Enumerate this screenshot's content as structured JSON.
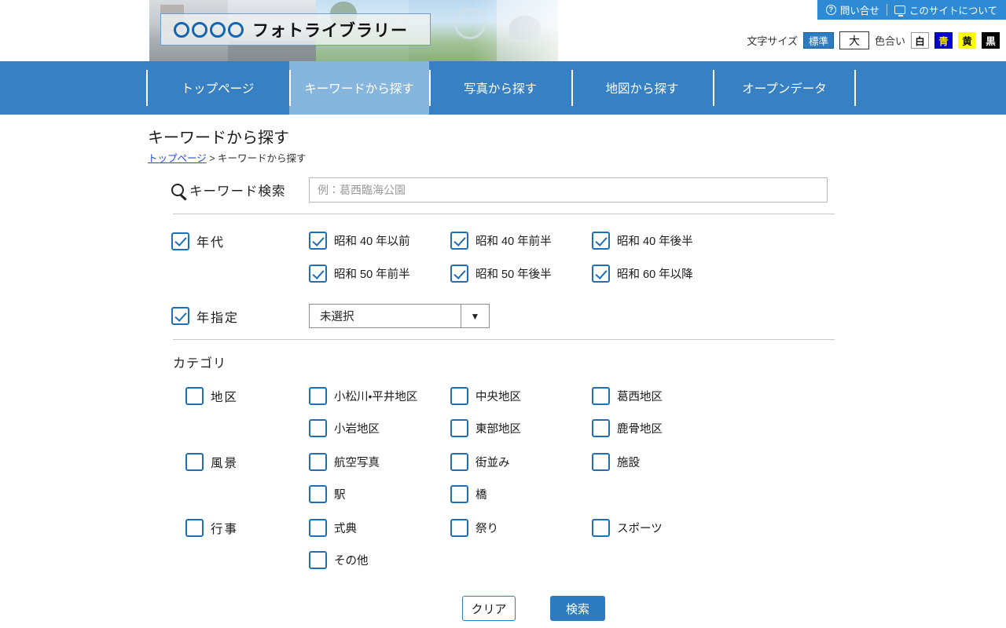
{
  "header": {
    "logo_circles": 4,
    "logo_text": "フォトライブラリー",
    "utility": {
      "contact": "問い合せ",
      "about": "このサイトについて",
      "contact_icon": "question-circle-icon",
      "about_icon": "monitor-icon"
    },
    "preferences": {
      "text_size_label": "文字サイズ",
      "size_standard": "標準",
      "size_large": "大",
      "color_label": "色合い",
      "color_white": "白",
      "color_blue": "青",
      "color_yellow": "黄",
      "color_black": "黒"
    }
  },
  "nav": {
    "items": [
      {
        "label": "トップページ",
        "active": false
      },
      {
        "label": "キーワードから探す",
        "active": true
      },
      {
        "label": "写真から探す",
        "active": false
      },
      {
        "label": "地図から探す",
        "active": false
      },
      {
        "label": "オープンデータ",
        "active": false
      }
    ]
  },
  "page": {
    "title": "キーワードから探す",
    "breadcrumb_home": "トップページ",
    "breadcrumb_sep": ">",
    "breadcrumb_current": "キーワードから探す"
  },
  "search": {
    "label": "キーワード検索",
    "icon": "search-icon",
    "value": "",
    "placeholder": "例：葛西臨海公園"
  },
  "era": {
    "group_label": "年代",
    "group_checked": true,
    "options": [
      {
        "label": "昭和 40 年以前",
        "checked": true
      },
      {
        "label": "昭和 40 年前半",
        "checked": true
      },
      {
        "label": "昭和 40 年後半",
        "checked": true
      },
      {
        "label": "昭和 50 年前半",
        "checked": true
      },
      {
        "label": "昭和 50 年後半",
        "checked": true
      },
      {
        "label": "昭和 60 年以降",
        "checked": true
      }
    ]
  },
  "year": {
    "label": "年指定",
    "checked": true,
    "selected": "未選択",
    "arrow_icon": "chevron-down-icon"
  },
  "category": {
    "title": "カテゴリ",
    "groups": [
      {
        "label": "地区",
        "checked": false,
        "options": [
          {
            "label": "小松川・平井地区",
            "checked": false
          },
          {
            "label": "中央地区",
            "checked": false
          },
          {
            "label": "葛西地区",
            "checked": false
          },
          {
            "label": "小岩地区",
            "checked": false
          },
          {
            "label": "東部地区",
            "checked": false
          },
          {
            "label": "鹿骨地区",
            "checked": false
          }
        ]
      },
      {
        "label": "風景",
        "checked": false,
        "options": [
          {
            "label": "航空写真",
            "checked": false
          },
          {
            "label": "街並み",
            "checked": false
          },
          {
            "label": "施設",
            "checked": false
          },
          {
            "label": "駅",
            "checked": false
          },
          {
            "label": "橋",
            "checked": false
          }
        ]
      },
      {
        "label": "行事",
        "checked": false,
        "options": [
          {
            "label": "式典",
            "checked": false
          },
          {
            "label": "祭り",
            "checked": false
          },
          {
            "label": "スポーツ",
            "checked": false
          },
          {
            "label": "その他",
            "checked": false
          }
        ]
      }
    ]
  },
  "actions": {
    "clear": "クリア",
    "search": "検索"
  },
  "colors": {
    "nav_blue": "#3680c3",
    "nav_active_blue": "#86b6dd",
    "accent_blue": "#2e7cc0",
    "checkbox_blue": "#1d6fb8",
    "link_blue": "#2a49d0"
  }
}
